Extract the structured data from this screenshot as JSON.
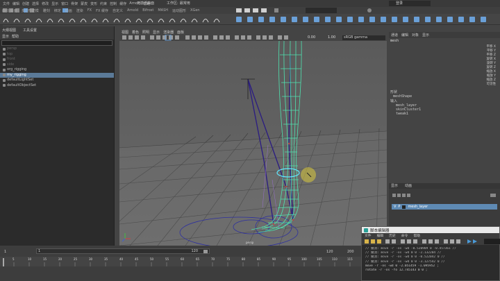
{
  "menubar": {
    "items": [
      "文件",
      "编辑",
      "创建",
      "选择",
      "修改",
      "显示",
      "窗口",
      "骨架",
      "蒙皮",
      "变形",
      "约束",
      "控制",
      "缓存",
      "Arnold",
      "帮助"
    ],
    "workspace_label": "工作区:",
    "workspace_value": "最常用",
    "login": "登录"
  },
  "shelf_tabs": [
    "曲线/曲面",
    "多边形建模",
    "雕刻",
    "绑定",
    "动画",
    "渲染",
    "FX",
    "FX 缓存",
    "自定义",
    "Arnold",
    "Bifrost",
    "MASH",
    "运动图形",
    "XGen"
  ],
  "outliner": {
    "tabs": [
      "大纲视图",
      "工具设置"
    ],
    "menu": [
      "显示",
      "帮助"
    ],
    "items": [
      {
        "label": "persp",
        "dim": true
      },
      {
        "label": "top",
        "dim": true
      },
      {
        "label": "front",
        "dim": true
      },
      {
        "label": "side",
        "dim": true
      },
      {
        "label": "org_rigging",
        "dim": false
      },
      {
        "label": "my_rigging",
        "dim": false,
        "selected": true
      },
      {
        "label": "defaultLightSet",
        "dim": false
      },
      {
        "label": "defaultObjectSet",
        "dim": false
      }
    ]
  },
  "viewport": {
    "menu": [
      "视图",
      "着色",
      "照明",
      "显示",
      "渲染器",
      "面板"
    ],
    "exposure": "0.00",
    "gamma": "1.00",
    "colorspace": "sRGB gamma",
    "label": "persp"
  },
  "channel_box": {
    "tabs": [
      "通道",
      "编辑",
      "对象",
      "显示"
    ],
    "object": "mesh",
    "attributes": [
      "平移 X",
      "平移 Y",
      "平移 Z",
      "旋转 X",
      "旋转 Y",
      "旋转 Z",
      "缩放 X",
      "缩放 Y",
      "缩放 Z",
      "可见性"
    ],
    "shapes_label": "形状",
    "shape": "meshShape",
    "inputs_label": "输入",
    "inputs": [
      "mesh_layer",
      "skinCluster1",
      "tweak1"
    ]
  },
  "layer_editor": {
    "tabs": [
      "显示",
      "动画"
    ],
    "layer_name": "mesh_layer",
    "v": "V",
    "p": "P"
  },
  "timeline": {
    "start": "1",
    "range_start": "1",
    "range_end_inner": "120",
    "range_end": "120",
    "end": "200",
    "ticks": [
      "5",
      "10",
      "15",
      "20",
      "25",
      "30",
      "35",
      "40",
      "45",
      "50",
      "55",
      "60",
      "65",
      "70",
      "75",
      "80",
      "85",
      "90",
      "95",
      "100",
      "105",
      "110",
      "115",
      "120"
    ]
  },
  "script_editor": {
    "title": "脚本编辑器",
    "menu": [
      "文件",
      "编辑",
      "历史",
      "命令",
      "帮助"
    ],
    "log": [
      "// 撤消: move -r -os -wd -0.520909 0 -0.457361  //",
      "// 撤消: move -r -os -wd 0 0 -2.132204  //",
      "// 撤消: move -r -os -wd 0 0 -0.522042 0  //",
      "// 撤消: move -r -os -wd 0 0 -3.127542 0  //",
      "move -r -os -wd 0 -2.051459 -1.095952 ;",
      "rotate -r -os -fo 12.745143 0 0 ;"
    ]
  },
  "colors": {
    "selection": "#5b7a98",
    "mesh_wire": "#4fe3b0",
    "joint": "#3b2a8a",
    "manipulator": "#d9c83a"
  }
}
